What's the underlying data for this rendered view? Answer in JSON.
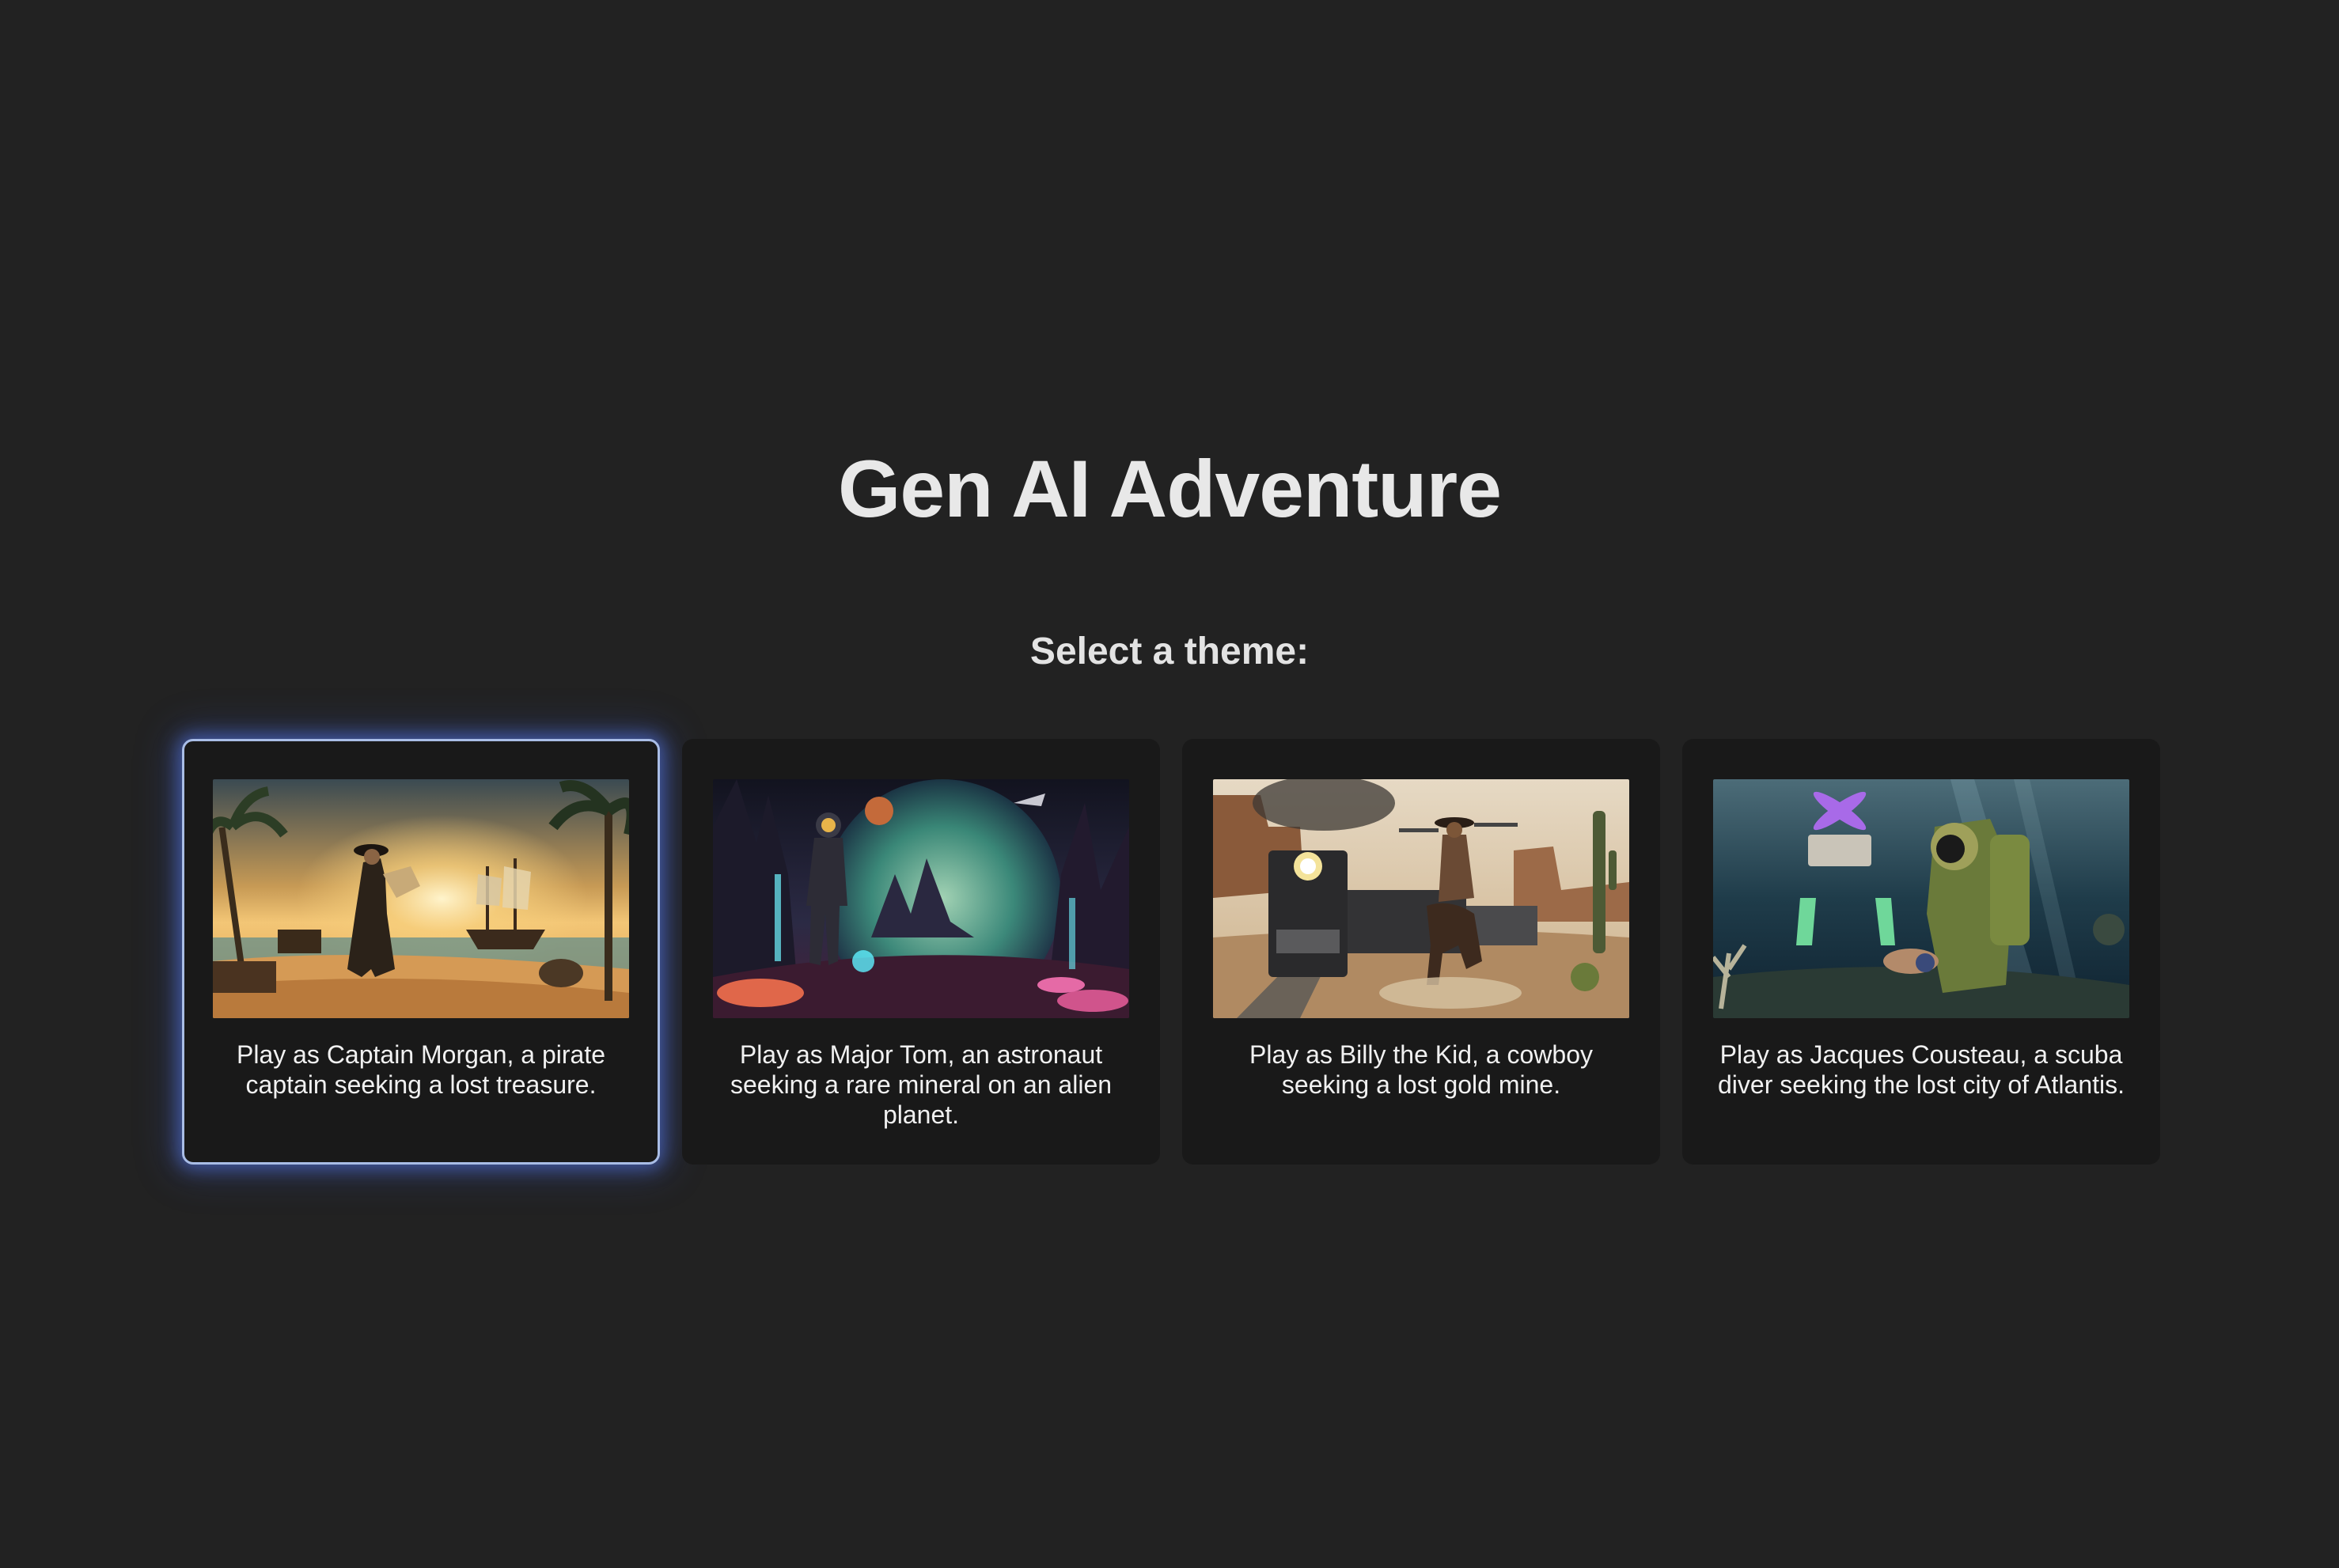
{
  "page": {
    "title": "Gen AI Adventure",
    "subtitle": "Select a theme:"
  },
  "themes": [
    {
      "description": "Play as Captain Morgan, a pirate captain seeking a lost treasure.",
      "image_icon": "pirate-beach-illustration",
      "selected": true
    },
    {
      "description": "Play as Major Tom, an astronaut seeking a rare mineral on an alien planet.",
      "image_icon": "alien-planet-illustration",
      "selected": false
    },
    {
      "description": "Play as Billy the Kid, a cowboy seeking a lost gold mine.",
      "image_icon": "wild-west-train-illustration",
      "selected": false
    },
    {
      "description": "Play as Jacques Cousteau, a scuba diver seeking the lost city of Atlantis.",
      "image_icon": "underwater-diver-illustration",
      "selected": false
    }
  ],
  "colors": {
    "background": "#222222",
    "card": "#191919",
    "selected_border": "#a9bde6",
    "selected_glow": "#587aeb",
    "text": "#e6e6e6"
  }
}
